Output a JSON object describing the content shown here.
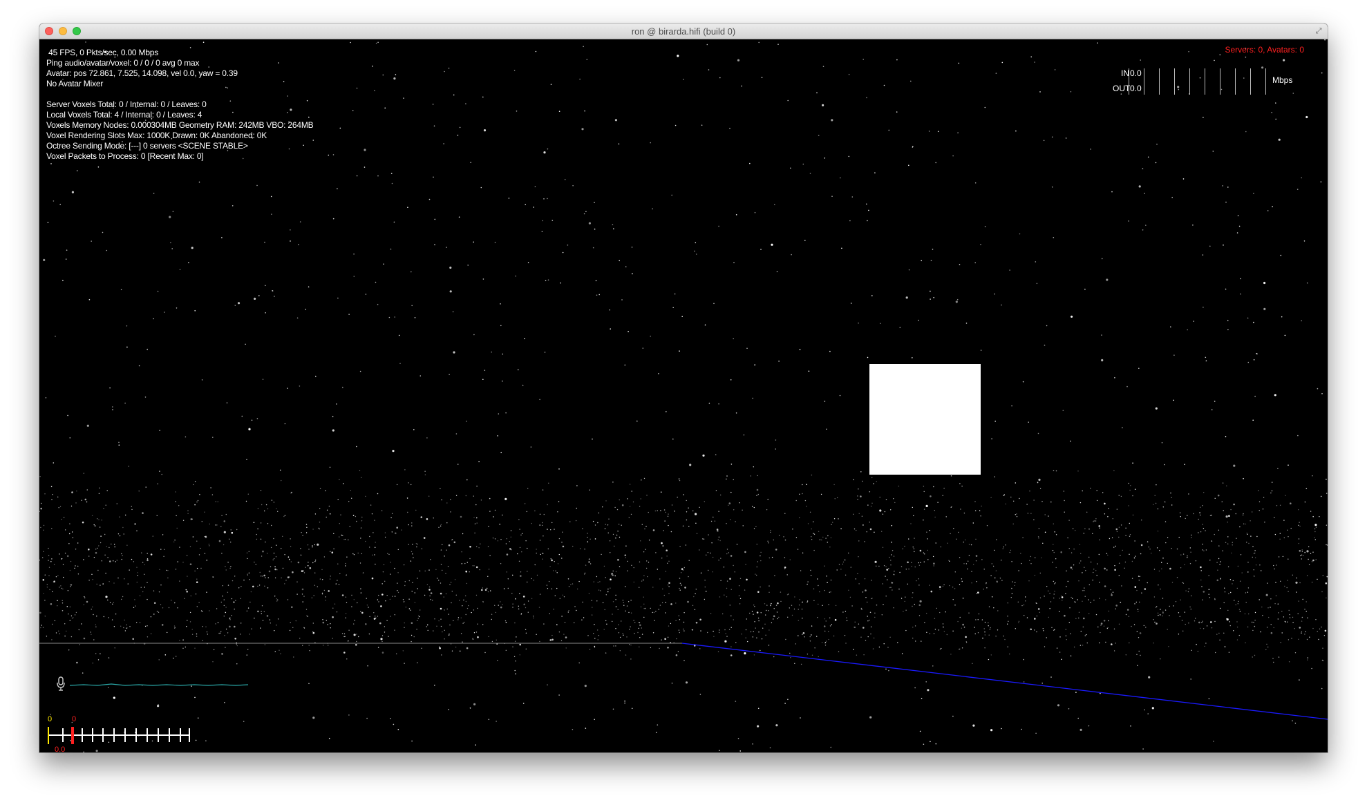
{
  "window": {
    "title": "ron @ birarda.hifi (build 0)"
  },
  "stats": {
    "lines": [
      " 45 FPS, 0 Pkts/sec, 0.00 Mbps",
      "Ping audio/avatar/voxel: 0 / 0 / 0 avg 0 max",
      "Avatar: pos 72.861, 7.525, 14.098, vel 0.0, yaw = 0.39",
      "No Avatar Mixer",
      "",
      "Server Voxels Total: 0 / Internal: 0 / Leaves: 0",
      "Local Voxels Total: 4 / Internal: 0 / Leaves: 4",
      "Voxels Memory Nodes: 0.000304MB Geometry RAM: 242MB VBO: 264MB",
      "Voxel Rendering Slots Max: 1000K Drawn: 0K Abandoned: 0K",
      "Octree Sending Mode: [---] 0 servers <SCENE STABLE>",
      "Voxel Packets to Process: 0 [Recent Max: 0]"
    ]
  },
  "servers_status": "Servers: 0, Avatars: 0",
  "bandwidth": {
    "in_label": "IN",
    "in_value": "0.0",
    "out_label": "OUT",
    "out_value": "0.0",
    "unit": "Mbps"
  },
  "audio_meter": {
    "yellow_label": "0",
    "red_label": "0",
    "level_label": "0.0"
  },
  "icons": {
    "mic": "microphone-icon",
    "fullscreen": "fullscreen-icon"
  },
  "colors": {
    "background": "#000000",
    "stars": "#ffffff",
    "server_status": "#ff2020",
    "horizon": "#888888",
    "axis_line": "#1a1aff",
    "meter_yellow": "#ffe900",
    "meter_red": "#ff2020"
  }
}
